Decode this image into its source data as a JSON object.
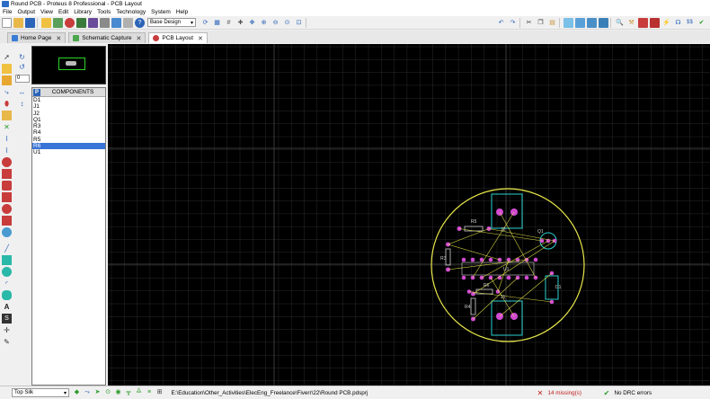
{
  "window": {
    "title": "Round PCB - Proteus 8 Professional - PCB Layout"
  },
  "menu": [
    "File",
    "Output",
    "View",
    "Edit",
    "Library",
    "Tools",
    "Technology",
    "System",
    "Help"
  ],
  "toolbar": {
    "design_select": "Base Design",
    "icons": [
      "new-file-icon",
      "open-folder-icon",
      "save-icon",
      "import-icon",
      "schematic-icon",
      "pcb-icon",
      "3d-icon",
      "gerber-icon",
      "bom-icon",
      "netlist-icon",
      "tools-icon",
      "help-icon"
    ],
    "right_icons": [
      "refresh-icon",
      "redraw-icon",
      "grid-icon",
      "origin-icon",
      "move-icon",
      "zoom-in-icon",
      "zoom-out-icon",
      "zoom-all-icon",
      "zoom-area-icon",
      "undo-icon",
      "redo-icon",
      "cut-icon",
      "copy-icon",
      "paste-icon",
      "block-copy-icon",
      "block-move-icon",
      "block-rotate-icon",
      "block-delete-icon",
      "pick-icon",
      "make-device-icon",
      "package-icon",
      "decompose-icon",
      "wire-autorouter-icon",
      "search-icon",
      "property-icon",
      "drc-icon",
      "design-rules-icon"
    ]
  },
  "tabs": [
    {
      "label": "Home Page",
      "color": "#3a7bd5"
    },
    {
      "label": "Schematic Capture",
      "color": "#4ca64c"
    },
    {
      "label": "PCB Layout",
      "color": "#c83c3c"
    }
  ],
  "rotation_value": "0",
  "components_panel": {
    "header_button": "P",
    "title": "COMPONENTS",
    "items": [
      "D1",
      "J1",
      "J2",
      "Q1",
      "R3",
      "R4",
      "R5",
      "R6",
      "U1"
    ],
    "selected_index": 7
  },
  "status": {
    "layer": "Top Silk",
    "file_path": "E:\\Education\\Other_Activities\\ElecEng_Freelance\\Fiverr\\22\\Round PCB.pdsprj",
    "missing": "14 missing(s)",
    "drc": "No DRC errors"
  },
  "colors": {
    "board_outline": "#e8e84a",
    "pad": "#d24ad2",
    "component_outline": "#2ad0d0",
    "ratsnest": "#e8e84a",
    "silk": "#d0d0d0",
    "grid": "#3a3a3a"
  },
  "pcb": {
    "labels": [
      "R5",
      "J2",
      "Q1",
      "U1",
      "R3",
      "R6",
      "R4",
      "J1",
      "D1"
    ]
  }
}
